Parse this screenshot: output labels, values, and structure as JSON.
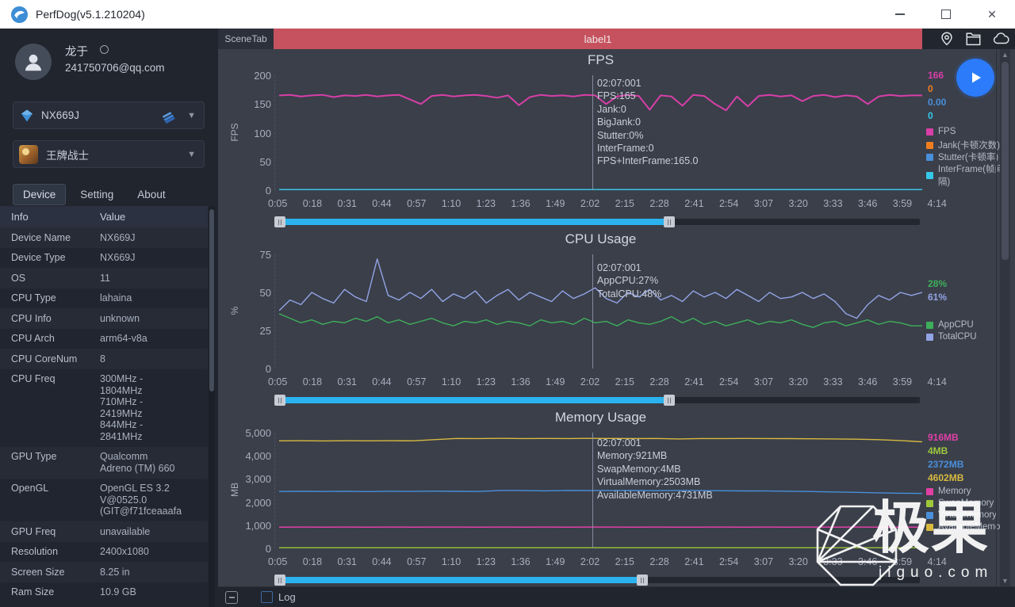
{
  "window": {
    "title": "PerfDog(v5.1.210204)",
    "controls": {
      "minimize": "minimize",
      "maximize": "maximize",
      "close": "✕"
    }
  },
  "topbar": {
    "scene_tab": "SceneTab",
    "scene_label": "label1",
    "scene_label_color": "#c5525e",
    "icons": [
      "location-pin",
      "folder",
      "cloud"
    ]
  },
  "sidebar": {
    "user": {
      "name": "龙于",
      "email": "241750706@qq.com"
    },
    "device_select": {
      "value": "NX669J",
      "icons": [
        "device-gem",
        "connection",
        "caret-down"
      ]
    },
    "app_select": {
      "value": "王牌战士",
      "icons": [
        "app-art",
        "caret-down"
      ]
    },
    "tabs": [
      {
        "label": "Device",
        "active": true
      },
      {
        "label": "Setting",
        "active": false
      },
      {
        "label": "About",
        "active": false
      }
    ],
    "table": {
      "headers": [
        "Info",
        "Value"
      ],
      "rows": [
        [
          "Device Name",
          "NX669J"
        ],
        [
          "Device Type",
          "NX669J"
        ],
        [
          "OS",
          "11"
        ],
        [
          "CPU Type",
          "lahaina"
        ],
        [
          "CPU Info",
          "unknown"
        ],
        [
          "CPU Arch",
          "arm64-v8a"
        ],
        [
          "CPU CoreNum",
          "8"
        ],
        [
          "CPU Freq",
          "300MHz -\n1804MHz\n710MHz -\n2419MHz\n844MHz -\n2841MHz"
        ],
        [
          "GPU Type",
          "Qualcomm\nAdreno (TM) 660"
        ],
        [
          "OpenGL",
          "OpenGL ES 3.2\nV@0525.0\n(GIT@f71fceaaafa"
        ],
        [
          "GPU Freq",
          "unavailable"
        ],
        [
          "Resolution",
          "2400x1080"
        ],
        [
          "Screen Size",
          "8.25 in"
        ],
        [
          "Ram Size",
          "10.9 GB"
        ]
      ]
    }
  },
  "bottombar": {
    "log_label": "Log",
    "log_checked": false
  },
  "watermark": {
    "title": "极果",
    "subtitle": "jiguo.com"
  },
  "chart_data": [
    {
      "type": "line",
      "title": "FPS",
      "ylabel": "FPS",
      "ylim": [
        0,
        200
      ],
      "yticks": [
        "200",
        "150",
        "100",
        "50",
        "0"
      ],
      "x_ticks": [
        "0:05",
        "0:18",
        "0:31",
        "0:44",
        "0:57",
        "1:10",
        "1:23",
        "1:36",
        "1:49",
        "2:02",
        "2:15",
        "2:28",
        "2:41",
        "2:54",
        "3:07",
        "3:20",
        "3:33",
        "3:46",
        "3:59",
        "4:14"
      ],
      "grid": false,
      "legend_position": "right",
      "cursor_tooltip": [
        "02:07:001",
        "FPS:165",
        "Jank:0",
        "BigJank:0",
        "Stutter:0%",
        "InterFrame:0",
        "FPS+InterFrame:165.0"
      ],
      "series": [
        {
          "name": "FPS",
          "color": "#d83fa7",
          "current": "166",
          "values": [
            165,
            166,
            163,
            165,
            166,
            162,
            165,
            164,
            166,
            163,
            165,
            166,
            158,
            150,
            164,
            166,
            163,
            165,
            166,
            164,
            161,
            165,
            148,
            162,
            166,
            164,
            165,
            163,
            166,
            165,
            150,
            163,
            166,
            164,
            140,
            165,
            163,
            147,
            166,
            164,
            150,
            139,
            163,
            146,
            164,
            166,
            163,
            165,
            155,
            164,
            166,
            162,
            165,
            163,
            150,
            163,
            166,
            164,
            165,
            165
          ]
        },
        {
          "name": "Jank(卡顿次数)",
          "color": "#ef7d1f",
          "current": "0",
          "values": [
            0
          ]
        },
        {
          "name": "Stutter(卡顿率)",
          "color": "#4a8fd9",
          "current": "0.00",
          "values": [
            0
          ]
        },
        {
          "name": "InterFrame(帧间隔)",
          "color": "#35c8e8",
          "current": "0",
          "values": [
            0
          ]
        }
      ]
    },
    {
      "type": "line",
      "title": "CPU Usage",
      "ylabel": "%",
      "ylim": [
        0,
        75
      ],
      "yticks": [
        "75",
        "50",
        "25",
        "0"
      ],
      "x_ticks": [
        "0:05",
        "0:18",
        "0:31",
        "0:44",
        "0:57",
        "1:10",
        "1:23",
        "1:36",
        "1:49",
        "2:02",
        "2:15",
        "2:28",
        "2:41",
        "2:54",
        "3:07",
        "3:20",
        "3:33",
        "3:46",
        "3:59",
        "4:14"
      ],
      "grid": false,
      "legend_position": "right",
      "cursor_tooltip": [
        "02:07:001",
        "AppCPU:27%",
        "TotalCPU:48%"
      ],
      "series": [
        {
          "name": "AppCPU",
          "color": "#3fae5a",
          "current": "28%",
          "values": [
            36,
            33,
            30,
            32,
            29,
            31,
            30,
            33,
            31,
            34,
            30,
            32,
            29,
            31,
            33,
            30,
            28,
            31,
            30,
            32,
            29,
            31,
            30,
            28,
            32,
            30,
            31,
            29,
            33,
            30,
            31,
            28,
            32,
            30,
            29,
            31,
            34,
            30,
            33,
            29,
            31,
            28,
            30,
            32,
            29,
            31,
            30,
            32,
            29,
            27,
            30,
            31,
            28,
            30,
            32,
            29,
            31,
            30,
            28,
            28
          ]
        },
        {
          "name": "TotalCPU",
          "color": "#93a4e6",
          "current": "61%",
          "values": [
            38,
            45,
            42,
            50,
            46,
            43,
            52,
            47,
            44,
            72,
            48,
            45,
            50,
            46,
            52,
            44,
            49,
            46,
            51,
            43,
            48,
            52,
            45,
            50,
            47,
            44,
            51,
            46,
            49,
            53,
            46,
            43,
            50,
            47,
            52,
            45,
            48,
            44,
            51,
            47,
            50,
            46,
            52,
            48,
            44,
            50,
            46,
            47,
            50,
            46,
            49,
            44,
            36,
            33,
            42,
            48,
            45,
            50,
            48,
            50
          ]
        }
      ]
    },
    {
      "type": "line",
      "title": "Memory Usage",
      "ylabel": "MB",
      "ylim": [
        0,
        5000
      ],
      "yticks": [
        "5,000",
        "4,000",
        "3,000",
        "2,000",
        "1,000",
        "0"
      ],
      "x_ticks": [
        "0:05",
        "0:18",
        "0:31",
        "0:44",
        "0:57",
        "1:10",
        "1:23",
        "1:36",
        "1:49",
        "2:02",
        "2:15",
        "2:28",
        "2:41",
        "2:54",
        "3:07",
        "3:20",
        "3:33",
        "3:46",
        "3:59",
        "4:14"
      ],
      "grid": false,
      "legend_position": "right",
      "cursor_tooltip": [
        "02:07:001",
        "Memory:921MB",
        "SwapMemory:4MB",
        "VirtualMemory:2503MB",
        "AvailableMemory:4731MB"
      ],
      "series": [
        {
          "name": "Memory",
          "color": "#e040a5",
          "current": "916MB",
          "values": [
            918,
            920,
            917,
            921,
            919,
            922,
            918,
            921,
            920,
            917,
            921,
            919,
            922,
            918,
            921,
            920,
            918,
            921,
            919,
            917,
            920,
            918,
            921,
            919,
            922,
            918,
            920,
            917,
            919,
            916
          ]
        },
        {
          "name": "SwapMemory",
          "color": "#9ec73c",
          "current": "4MB",
          "values": [
            4
          ]
        },
        {
          "name": "VirtualMemory",
          "color": "#4a8fd9",
          "current": "2372MB",
          "values": [
            2460,
            2465,
            2458,
            2470,
            2455,
            2468,
            2462,
            2472,
            2466,
            2458,
            2503,
            2495,
            2488,
            2502,
            2498,
            2505,
            2500,
            2494,
            2502,
            2497,
            2490,
            2484,
            2478,
            2470,
            2455,
            2440,
            2420,
            2400,
            2385,
            2372
          ]
        },
        {
          "name": "AvailableMemory",
          "color": "#d8b93f",
          "current": "4602MB",
          "values": [
            4648,
            4652,
            4645,
            4650,
            4647,
            4652,
            4648,
            4700,
            4750,
            4748,
            4752,
            4746,
            4750,
            4748,
            4752,
            4749,
            4746,
            4750,
            4731,
            4748,
            4745,
            4750,
            4746,
            4742,
            4738,
            4730,
            4720,
            4700,
            4660,
            4602
          ]
        }
      ]
    }
  ]
}
